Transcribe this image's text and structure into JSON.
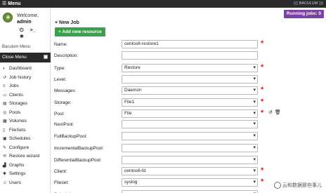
{
  "topbar": {
    "menu_label": "Menu",
    "brand": "((( BACULUM )))"
  },
  "user": {
    "welcome": "Welcome,",
    "name": "admin"
  },
  "sidebar": {
    "title": "Baculum Menu",
    "close_label": "Close Menu",
    "items": [
      {
        "label": "Dashboard",
        "icon": "dashboard-icon",
        "glyph": "◐"
      },
      {
        "label": "Job history",
        "icon": "history-icon",
        "glyph": "↺"
      },
      {
        "label": "Jobs",
        "icon": "list-icon",
        "glyph": "≡"
      },
      {
        "label": "Clients",
        "icon": "desktop-icon",
        "glyph": "▭"
      },
      {
        "label": "Storages",
        "icon": "database-icon",
        "glyph": "▤"
      },
      {
        "label": "Pools",
        "icon": "tape-icon",
        "glyph": "◎"
      },
      {
        "label": "Volumes",
        "icon": "hdd-icon",
        "glyph": "▦"
      },
      {
        "label": "FileSets",
        "icon": "files-icon",
        "glyph": "▯"
      },
      {
        "label": "Schedules",
        "icon": "calendar-icon",
        "glyph": "▣"
      },
      {
        "label": "Configure",
        "icon": "wrench-icon",
        "glyph": "✎"
      },
      {
        "label": "Restore wizard",
        "icon": "restore-icon",
        "glyph": "⟲"
      },
      {
        "label": "Graphs",
        "icon": "chart-icon",
        "glyph": "▟"
      },
      {
        "label": "Settings",
        "icon": "gear-icon",
        "glyph": "✱"
      },
      {
        "label": "Users",
        "icon": "users-icon",
        "glyph": "☺"
      }
    ]
  },
  "main": {
    "running_jobs": "Running jobs: 0",
    "new_job": "+ New Job",
    "add_resource": "+ Add new resource",
    "form": [
      {
        "label": "Name:",
        "value": "centos6-restore1",
        "type": "text",
        "required": true
      },
      {
        "label": "Description:",
        "value": "",
        "type": "text",
        "required": false
      },
      {
        "label": "Type:",
        "value": "Restore",
        "type": "select",
        "required": true
      },
      {
        "label": "Level:",
        "value": "",
        "type": "select",
        "required": false
      },
      {
        "label": "Messages:",
        "value": "Daemon",
        "type": "select",
        "required": true
      },
      {
        "label": "Storage:",
        "value": "File1",
        "type": "select",
        "required": true
      },
      {
        "label": "Pool:",
        "value": "File",
        "type": "select",
        "required": true
      },
      {
        "label": "NextPool:",
        "value": "",
        "type": "select",
        "required": false
      },
      {
        "label": "FullBackupPool:",
        "value": "",
        "type": "select",
        "required": false
      },
      {
        "label": "IncrementalBackupPool:",
        "value": "",
        "type": "select",
        "required": false
      },
      {
        "label": "DifferentialBackupPool:",
        "value": "",
        "type": "select",
        "required": false
      },
      {
        "label": "Client:",
        "value": "centos6-fd",
        "type": "select",
        "required": true
      },
      {
        "label": "Fileset:",
        "value": "syslog",
        "type": "select",
        "required": true
      },
      {
        "label": "Schedule:",
        "value": "",
        "type": "select",
        "required": false
      }
    ]
  },
  "watermark": "云和数据那些事儿"
}
